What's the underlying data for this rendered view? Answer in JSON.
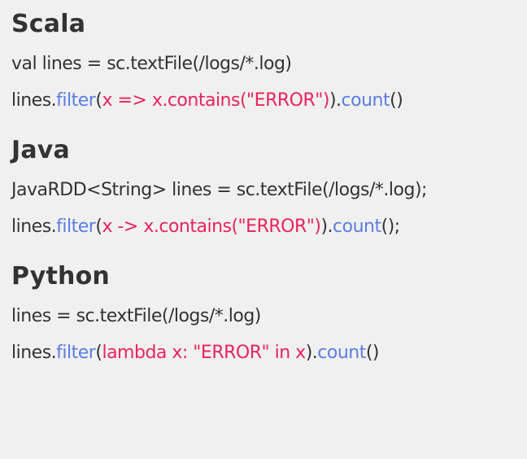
{
  "colors": {
    "background": "#f0f0f0",
    "text": "#333333",
    "method": "#5b7de0",
    "argument": "#e8245c"
  },
  "sections": [
    {
      "heading": "Scala",
      "lines": [
        [
          {
            "text": "val lines = sc.textFile(/logs/*.log)",
            "kind": "plain"
          }
        ],
        [
          {
            "text": "lines.",
            "kind": "plain"
          },
          {
            "text": "filter",
            "kind": "method"
          },
          {
            "text": "(",
            "kind": "plain"
          },
          {
            "text": "x => x.contains(\"ERROR\")",
            "kind": "arg"
          },
          {
            "text": ").",
            "kind": "plain"
          },
          {
            "text": "count",
            "kind": "method"
          },
          {
            "text": "()",
            "kind": "plain"
          }
        ]
      ]
    },
    {
      "heading": "Java",
      "lines": [
        [
          {
            "text": "JavaRDD<String> lines = sc.textFile(/logs/*.log);",
            "kind": "plain"
          }
        ],
        [
          {
            "text": "lines.",
            "kind": "plain"
          },
          {
            "text": "filter",
            "kind": "method"
          },
          {
            "text": "(",
            "kind": "plain"
          },
          {
            "text": "x -> x.contains(\"ERROR\")",
            "kind": "arg"
          },
          {
            "text": ").",
            "kind": "plain"
          },
          {
            "text": "count",
            "kind": "method"
          },
          {
            "text": "();",
            "kind": "plain"
          }
        ]
      ]
    },
    {
      "heading": "Python",
      "lines": [
        [
          {
            "text": "lines = sc.textFile(/logs/*.log)",
            "kind": "plain"
          }
        ],
        [
          {
            "text": "lines.",
            "kind": "plain"
          },
          {
            "text": "filter",
            "kind": "method"
          },
          {
            "text": "(",
            "kind": "plain"
          },
          {
            "text": "lambda x: \"ERROR\" in x",
            "kind": "arg"
          },
          {
            "text": ").",
            "kind": "plain"
          },
          {
            "text": "count",
            "kind": "method"
          },
          {
            "text": "()",
            "kind": "plain"
          }
        ]
      ]
    }
  ]
}
